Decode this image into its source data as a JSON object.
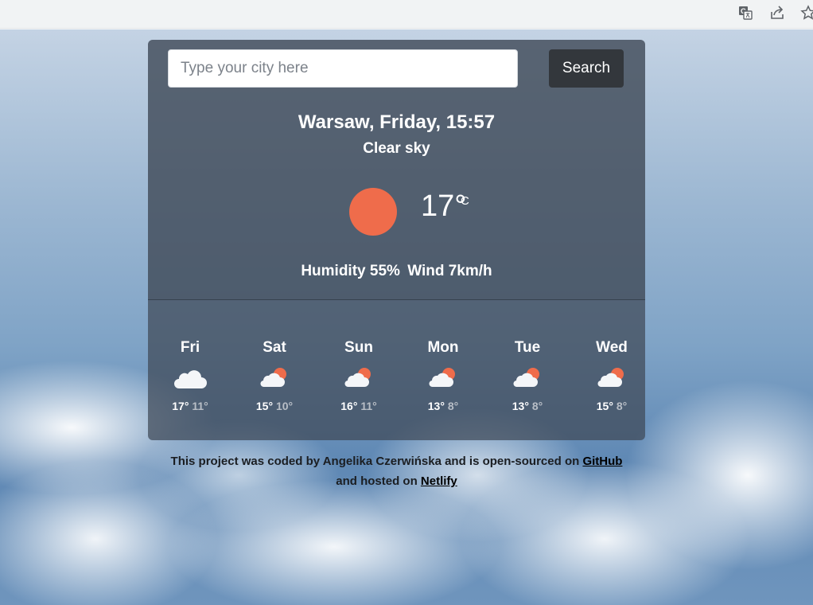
{
  "browser": {
    "icons": [
      "translate-icon",
      "share-icon",
      "bookmark-star-icon"
    ]
  },
  "search": {
    "placeholder": "Type your city here",
    "button_label": "Search"
  },
  "current": {
    "city_line": "Warsaw, Friday, 15:57",
    "description": "Clear sky",
    "temperature": "17°",
    "unit": "C",
    "humidity": "Humidity 55%",
    "wind": "Wind 7km/h",
    "icon": "sun-icon"
  },
  "forecast": [
    {
      "day": "Fri",
      "max": "17°",
      "min": "11°",
      "icon": "cloud-icon"
    },
    {
      "day": "Sat",
      "max": "15°",
      "min": "10°",
      "icon": "partly-cloudy-icon"
    },
    {
      "day": "Sun",
      "max": "16°",
      "min": "11°",
      "icon": "partly-cloudy-icon"
    },
    {
      "day": "Mon",
      "max": "13°",
      "min": "8°",
      "icon": "partly-cloudy-icon"
    },
    {
      "day": "Tue",
      "max": "13°",
      "min": "8°",
      "icon": "partly-cloudy-icon"
    },
    {
      "day": "Wed",
      "max": "15°",
      "min": "8°",
      "icon": "partly-cloudy-icon"
    }
  ],
  "footer": {
    "text_before": "This project was coded by Angelika Czerwińska and is open-sourced on",
    "github_link": "GitHub",
    "text_middle": "and hosted on",
    "netlify_link": "Netlify"
  },
  "colors": {
    "sun": "#ef6c4b",
    "button": "#33373c",
    "card": "#3e4856"
  }
}
